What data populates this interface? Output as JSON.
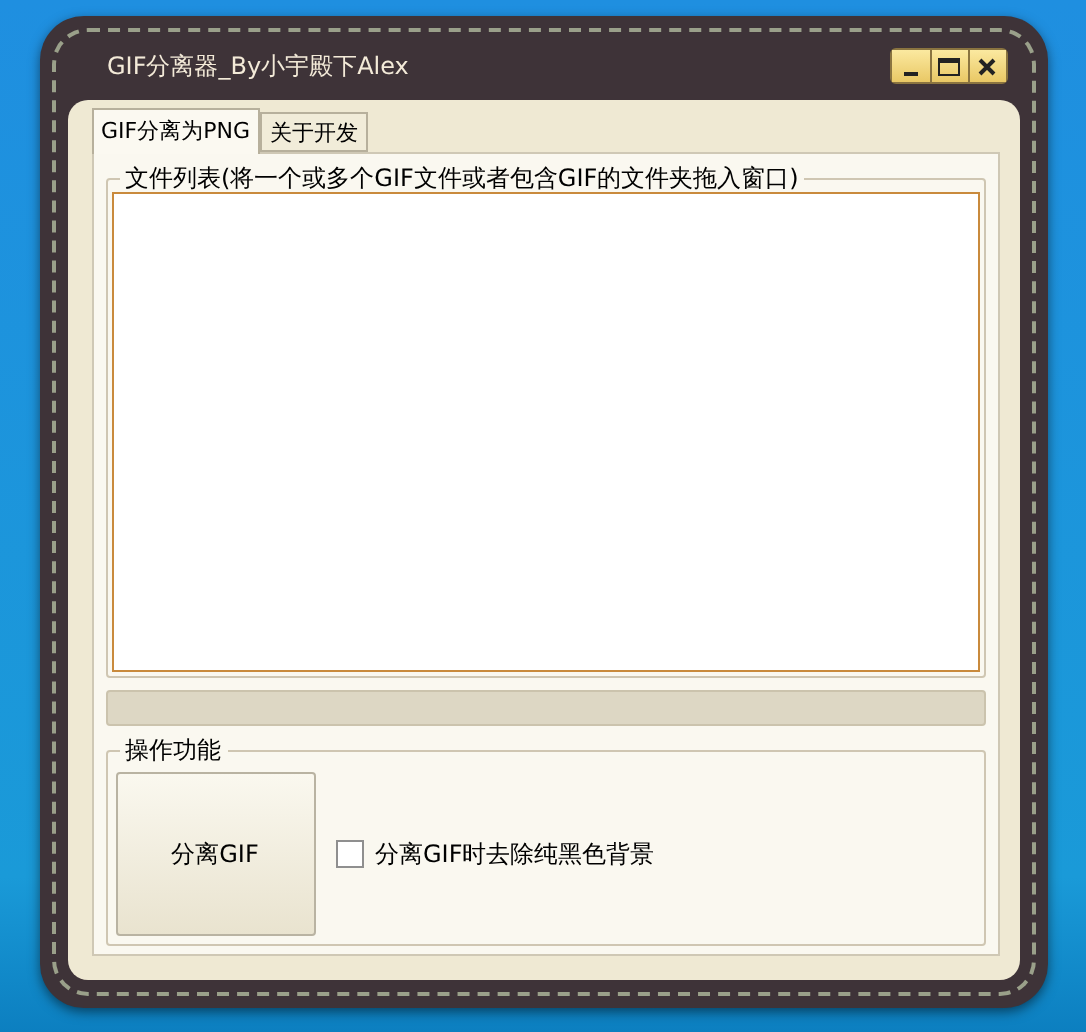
{
  "window": {
    "title": "GIF分离器_By小宇殿下Alex",
    "controls": [
      {
        "kind": "minimize"
      },
      {
        "kind": "maximize"
      },
      {
        "kind": "close"
      }
    ]
  },
  "tabs": [
    {
      "label": "GIF分离为PNG",
      "selected": true
    },
    {
      "label": "关于开发",
      "selected": false
    }
  ],
  "file_list": {
    "title": "文件列表(将一个或多个GIF文件或者包含GIF的文件夹拖入窗口)"
  },
  "operations": {
    "title": "操作功能",
    "button": "分离GIF",
    "checkbox": {
      "label": "分离GIF时去除纯黑色背景",
      "checked": false
    }
  }
}
